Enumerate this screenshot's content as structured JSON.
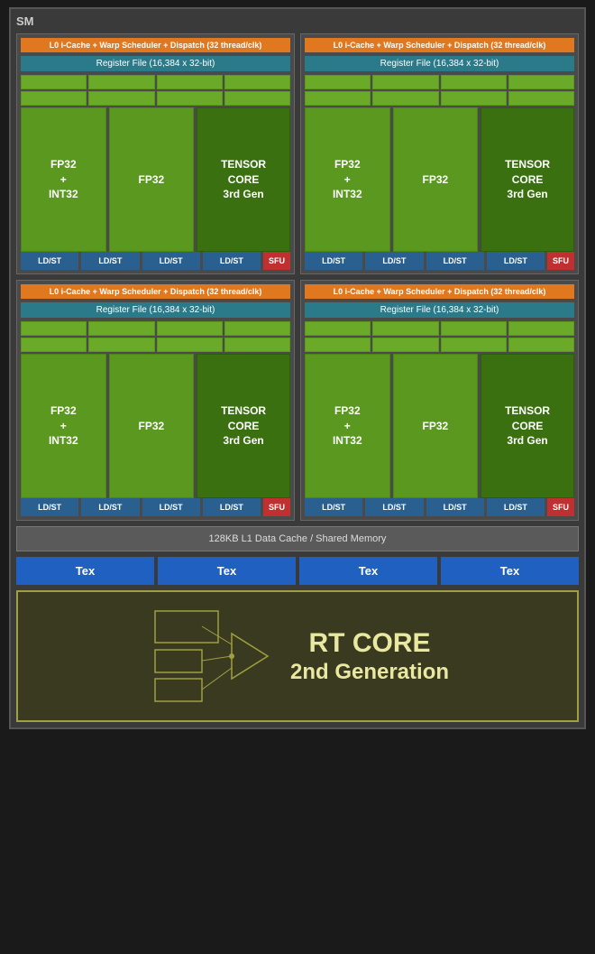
{
  "sm": {
    "label": "SM",
    "partitions": [
      {
        "id": "partition-0",
        "l0_cache": "L0 i-Cache + Warp Scheduler + Dispatch (32 thread/clk)",
        "register_file": "Register File (16,384 x 32-bit)",
        "fp32_int32": "FP32\n+\nINT32",
        "fp32": "FP32",
        "tensor_core": "TENSOR\nCORE\n3rd Gen",
        "ld_st_cells": [
          "LD/ST",
          "LD/ST",
          "LD/ST",
          "LD/ST"
        ],
        "sfu": "SFU"
      },
      {
        "id": "partition-1",
        "l0_cache": "L0 i-Cache + Warp Scheduler + Dispatch (32 thread/clk)",
        "register_file": "Register File (16,384 x 32-bit)",
        "fp32_int32": "FP32\n+\nINT32",
        "fp32": "FP32",
        "tensor_core": "TENSOR\nCORE\n3rd Gen",
        "ld_st_cells": [
          "LD/ST",
          "LD/ST",
          "LD/ST",
          "LD/ST"
        ],
        "sfu": "SFU"
      },
      {
        "id": "partition-2",
        "l0_cache": "L0 i-Cache + Warp Scheduler + Dispatch (32 thread/clk)",
        "register_file": "Register File (16,384 x 32-bit)",
        "fp32_int32": "FP32\n+\nINT32",
        "fp32": "FP32",
        "tensor_core": "TENSOR\nCORE\n3rd Gen",
        "ld_st_cells": [
          "LD/ST",
          "LD/ST",
          "LD/ST",
          "LD/ST"
        ],
        "sfu": "SFU"
      },
      {
        "id": "partition-3",
        "l0_cache": "L0 i-Cache + Warp Scheduler + Dispatch (32 thread/clk)",
        "register_file": "Register File (16,384 x 32-bit)",
        "fp32_int32": "FP32\n+\nINT32",
        "fp32": "FP32",
        "tensor_core": "TENSOR\nCORE\n3rd Gen",
        "ld_st_cells": [
          "LD/ST",
          "LD/ST",
          "LD/ST",
          "LD/ST"
        ],
        "sfu": "SFU"
      }
    ],
    "l1_cache": "128KB L1 Data Cache / Shared Memory",
    "tex_units": [
      "Tex",
      "Tex",
      "Tex",
      "Tex"
    ],
    "rt_core": {
      "title": "RT CORE",
      "subtitle": "2nd Generation"
    }
  }
}
